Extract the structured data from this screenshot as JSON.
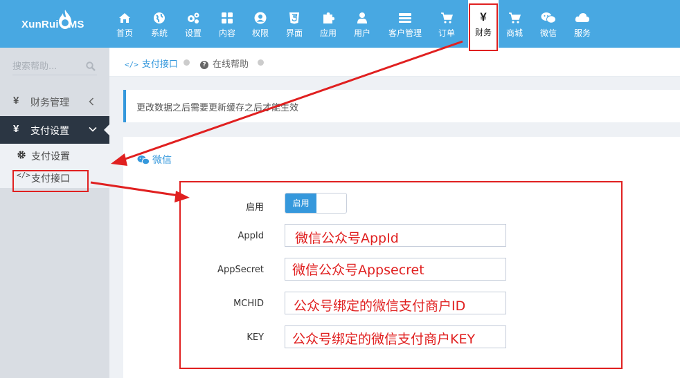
{
  "brand": {
    "logo_text": "XunRui",
    "logo_suffix": "MS"
  },
  "nav": [
    {
      "label": "首页",
      "icon": "home-icon"
    },
    {
      "label": "系统",
      "icon": "globe-icon"
    },
    {
      "label": "设置",
      "icon": "cogs-icon"
    },
    {
      "label": "内容",
      "icon": "grid-icon"
    },
    {
      "label": "权限",
      "icon": "user-circle-icon"
    },
    {
      "label": "界面",
      "icon": "html5-icon"
    },
    {
      "label": "应用",
      "icon": "puzzle-icon"
    },
    {
      "label": "用户",
      "icon": "user-icon"
    },
    {
      "label": "客户管理",
      "icon": "list-icon"
    },
    {
      "label": "订单",
      "icon": "cart-icon"
    },
    {
      "label": "财务",
      "icon": "yen-icon",
      "active": true,
      "symbol": "¥"
    },
    {
      "label": "商城",
      "icon": "cart-icon"
    },
    {
      "label": "微信",
      "icon": "wechat-icon"
    },
    {
      "label": "服务",
      "icon": "cloud-icon"
    }
  ],
  "sidebar": {
    "search_placeholder": "搜索帮助...",
    "yen": "¥",
    "groups": [
      {
        "label": "财务管理",
        "expanded": false
      },
      {
        "label": "支付设置",
        "expanded": true
      }
    ],
    "subitems": [
      {
        "label": "支付设置",
        "icon": "gear-icon"
      },
      {
        "label": "支付接口",
        "icon": "code-icon",
        "code": "</>"
      }
    ]
  },
  "breadcrumb": [
    {
      "label": "支付接口",
      "code": "</>"
    },
    {
      "label": "在线帮助",
      "q": "?"
    }
  ],
  "notice": "更改数据之后需要更新缓存之后才能生效",
  "card": {
    "title": "微信",
    "toggle_label": "启用",
    "toggle_on_text": "启用",
    "fields": [
      {
        "label": "AppId",
        "value": "微信公众号AppId"
      },
      {
        "label": "AppSecret",
        "value": "微信公众号Appsecret"
      },
      {
        "label": "MCHID",
        "value": "公众号绑定的微信支付商户ID"
      },
      {
        "label": "KEY",
        "value": "公众号绑定的微信支付商户KEY"
      }
    ]
  },
  "colors": {
    "topbar": "#48a8e2",
    "accent": "#3598dc",
    "annotation": "#e02020",
    "sidebar": "#d9dde3",
    "sidebar_active": "#2b3643"
  }
}
